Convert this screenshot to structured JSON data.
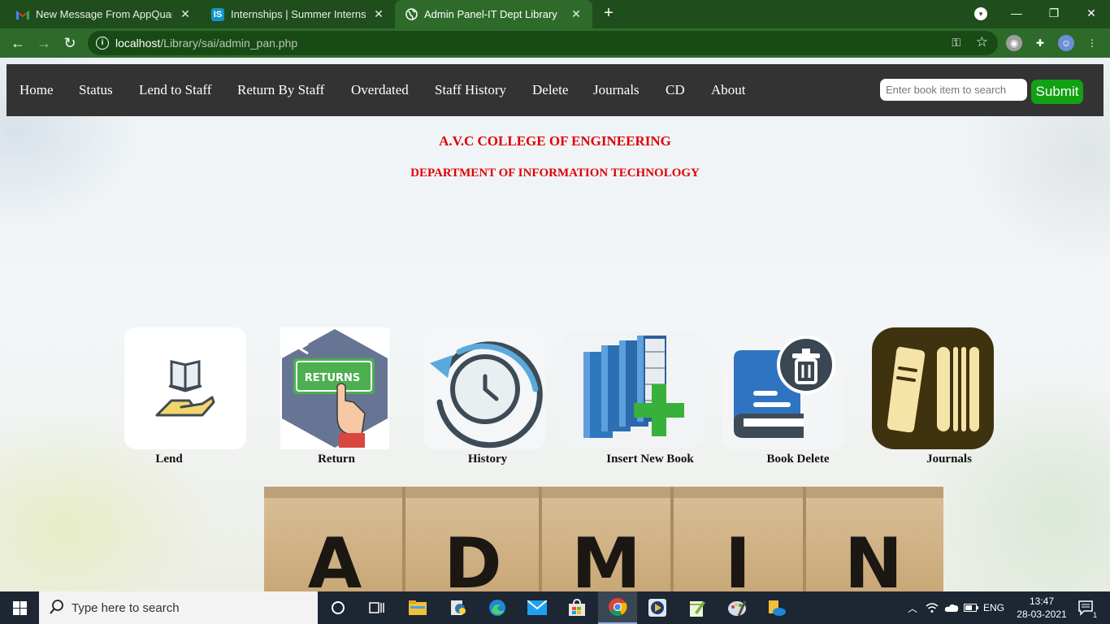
{
  "browser": {
    "tabs": [
      {
        "title": "New Message From AppQuarterz",
        "favicon": "gmail-icon",
        "active": false
      },
      {
        "title": "Internships | Summer Internship",
        "favicon": "internshala-icon",
        "active": false
      },
      {
        "title": "Admin Panel-IT Dept Library",
        "favicon": "globe-icon",
        "active": true
      }
    ],
    "favicon_text": {
      "internshala": "IS"
    },
    "new_tab": "+",
    "url_host": "localhost",
    "url_path": "/Library/sai/admin_pan.php",
    "theme_color": "#1f4e1c"
  },
  "navbar": {
    "links": [
      "Home",
      "Status",
      "Lend to Staff",
      "Return By Staff",
      "Overdated",
      "Staff History",
      "Delete",
      "Journals",
      "CD",
      "About"
    ],
    "search_placeholder": "Enter book item to search",
    "submit_label": "Submit",
    "bg_color": "#333333",
    "submit_color": "#12a112"
  },
  "header": {
    "college": "A.V.C COLLEGE OF ENGINEERING",
    "department": "DEPARTMENT OF INFORMATION TECHNOLOGY",
    "color": "#e00000"
  },
  "cards": [
    {
      "label": "Lend",
      "icon": "lend-book-hand-icon"
    },
    {
      "label": "Return",
      "icon": "returns-sign-icon"
    },
    {
      "label": "History",
      "icon": "history-clock-icon"
    },
    {
      "label": "Insert New Book",
      "icon": "insert-book-plus-icon"
    },
    {
      "label": "Book Delete",
      "icon": "book-delete-trash-icon"
    },
    {
      "label": "Journals",
      "icon": "journals-shelf-icon"
    }
  ],
  "returns_sign_text": "RETURNS",
  "background_blocks": [
    "A",
    "D",
    "M",
    "I",
    "N"
  ],
  "taskbar": {
    "search_placeholder": "Type here to search",
    "language": "ENG",
    "time": "13:47",
    "date": "28-03-2021",
    "notification_count": "1"
  }
}
